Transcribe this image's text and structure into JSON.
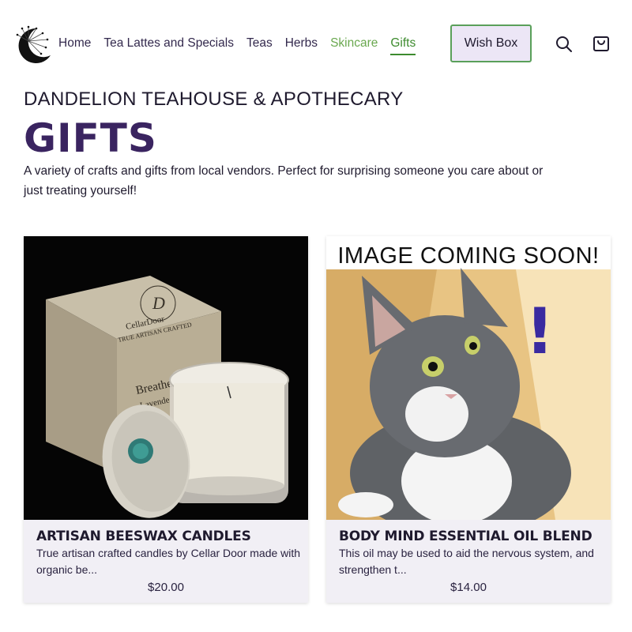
{
  "nav": {
    "items": [
      {
        "label": "Home"
      },
      {
        "label": "Tea Lattes and Specials"
      },
      {
        "label": "Teas"
      },
      {
        "label": "Herbs"
      },
      {
        "label": "Skincare"
      },
      {
        "label": "Gifts"
      }
    ],
    "wish_box_label": "Wish Box",
    "search_icon": "search-icon",
    "cart_icon": "shopping-bag-icon",
    "active_color": "#3d8b2e",
    "skincare_color": "#6aa84f"
  },
  "brand": {
    "name": "DANDELION TEAHOUSE & APOTHECARY",
    "logo_icon": "moon-dandelion-logo"
  },
  "page": {
    "title": "GIFTS",
    "title_color": "#3a2460",
    "intro": "A variety of crafts and gifts from local vendors. Perfect for surprising someone you care about or just treating yourself!"
  },
  "products": [
    {
      "title": "ARTISAN BEESWAX CANDLES",
      "description": "True artisan crafted candles by Cellar Door made with organic be...",
      "price": "$20.00",
      "image_text": {
        "brand": "CellarDoor",
        "tagline": "TRUE ARTISAN CRAFTED",
        "scent": "Breathe Easy",
        "scent_sub": "Lavende"
      }
    },
    {
      "title": "BODY MIND ESSENTIAL OIL BLEND",
      "description": "This oil may be used to aid the nervous system, and strengthen t...",
      "price": "$14.00",
      "image_text": {
        "banner": "IMAGE COMING SOON!",
        "exclaim": "!"
      }
    }
  ]
}
